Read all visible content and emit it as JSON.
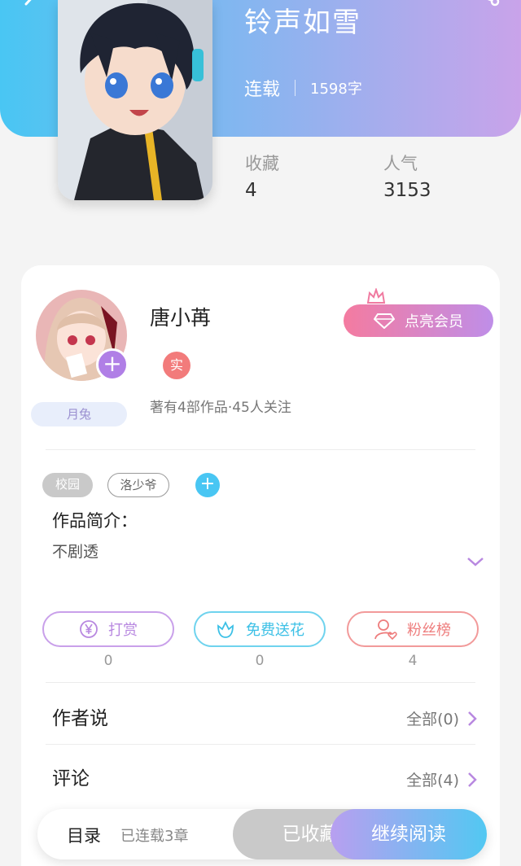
{
  "book": {
    "title": "铃声如雪",
    "status": "连载",
    "word_count": "1598字",
    "favorites_label": "收藏",
    "favorites_value": "4",
    "popularity_label": "人气",
    "popularity_value": "3153"
  },
  "author": {
    "name": "唐小苒",
    "real_badge": "实",
    "info": "著有4部作品·45人关注",
    "badge": "月兔",
    "follow_symbol": "+"
  },
  "vip_button": "点亮会员",
  "tags": [
    "校园",
    "洛少爷"
  ],
  "tag_add_symbol": "+",
  "intro": {
    "title": "作品简介：",
    "text": "不剧透"
  },
  "actions": [
    {
      "label": "打赏",
      "count": "0",
      "icon": "yen-icon"
    },
    {
      "label": "免费送花",
      "count": "0",
      "icon": "flower-icon"
    },
    {
      "label": "粉丝榜",
      "count": "4",
      "icon": "fan-rank-icon"
    }
  ],
  "author_says": {
    "title": "作者说",
    "more": "全部(0)"
  },
  "comments": {
    "title": "评论",
    "more": "全部(4)"
  },
  "bottom_bar": {
    "toc": "目录",
    "chapters": "已连载3章",
    "favorited": "已收藏",
    "continue": "继续阅读"
  },
  "colors": {
    "header_gradient": [
      "#49c6f3",
      "#c9a3ea"
    ],
    "accent_purple": "#b07fe6",
    "accent_cyan": "#49c6f3",
    "accent_red": "#f27b7b"
  }
}
